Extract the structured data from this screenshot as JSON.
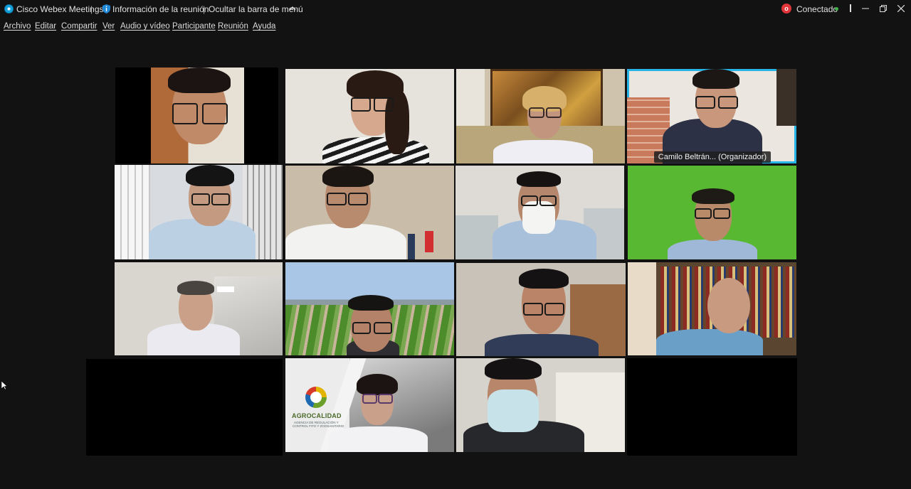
{
  "titlebar": {
    "app_name": "Cisco Webex Meetings",
    "separator": "|",
    "meeting_info": "Información de la reunión",
    "hide_menu": "Ocultar la barra de menú",
    "recording_badge": "o",
    "status": "Conectado",
    "icons": [
      "webex-app-icon",
      "shield-info-icon",
      "chevron-up-icon",
      "recording-icon",
      "connection-dot-icon",
      "minimize-icon",
      "restore-icon",
      "close-icon"
    ]
  },
  "menu": {
    "items": [
      "Archivo",
      "Editar",
      "Compartir",
      "Ver",
      "Audio y vídeo",
      "Participante",
      "Reunión",
      "Ayuda"
    ]
  },
  "grid": {
    "active_speaker_label": "Camilo Beltrán... (Organizador)",
    "logo_title": "AGROCALIDAD",
    "logo_subtitle_1": "AGENCIA DE REGULACIÓN Y",
    "logo_subtitle_2": "CONTROL FITO Y ZOOSANITARIO",
    "accent_color": "#27b5e8"
  }
}
